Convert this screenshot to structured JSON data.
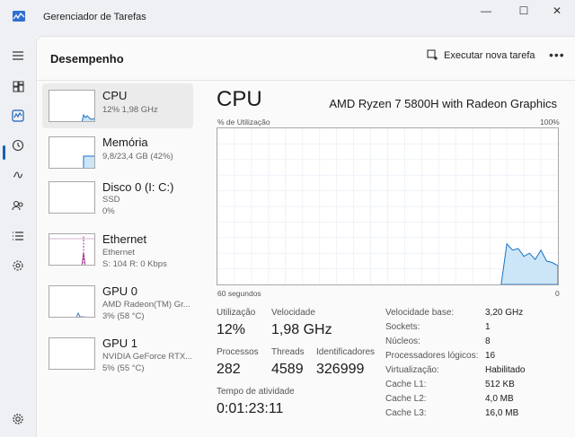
{
  "window": {
    "title": "Gerenciador de Tarefas",
    "minimize": "—",
    "maximize": "☐",
    "close": "✕"
  },
  "header": {
    "page_title": "Desempenho",
    "run_task_label": "Executar nova tarefa",
    "more_label": "•••"
  },
  "colors": {
    "cpu_accent": "#1a73c9",
    "cpu_fill": "#cde6f7",
    "disk_accent": "#4c9a2a",
    "ethernet_accent": "#a0358f",
    "gpu_accent": "#2b6cb0"
  },
  "sidebar": {
    "items": [
      {
        "name": "CPU",
        "sub1": "12%  1,98 GHz",
        "sub2": "",
        "level": 0.12
      },
      {
        "name": "Memória",
        "sub1": "9,8/23,4 GB (42%)",
        "sub2": "",
        "level": 0.42
      },
      {
        "name": "Disco 0 (I: C:)",
        "sub1": "SSD",
        "sub2": "0%",
        "level": 0
      },
      {
        "name": "Ethernet",
        "sub1": "Ethernet",
        "sub2": "S: 104  R: 0 Kbps",
        "level": 0
      },
      {
        "name": "GPU 0",
        "sub1": "AMD Radeon(TM) Gr...",
        "sub2": "3%  (58 °C)",
        "level": 0.03
      },
      {
        "name": "GPU 1",
        "sub1": "NVIDIA GeForce RTX...",
        "sub2": "5%  (55 °C)",
        "level": 0.05
      }
    ]
  },
  "detail": {
    "title": "CPU",
    "model": "AMD Ryzen 7 5800H with Radeon Graphics",
    "graph_top_left": "% de Utilização",
    "graph_top_right": "100%",
    "graph_bottom_left": "60 segundos",
    "graph_bottom_right": "0",
    "utilization_label": "Utilização",
    "utilization_value": "12%",
    "speed_label": "Velocidade",
    "speed_value": "1,98 GHz",
    "processes_label": "Processos",
    "processes_value": "282",
    "threads_label": "Threads",
    "threads_value": "4589",
    "handles_label": "Identificadores",
    "handles_value": "326999",
    "uptime_label": "Tempo de atividade",
    "uptime_value": "0:01:23:11",
    "specs": [
      {
        "key": "Velocidade base:",
        "value": "3,20 GHz"
      },
      {
        "key": "Sockets:",
        "value": "1"
      },
      {
        "key": "Núcleos:",
        "value": "8"
      },
      {
        "key": "Processadores lógicos:",
        "value": "16"
      },
      {
        "key": "Virtualização:",
        "value": "Habilitado"
      },
      {
        "key": "Cache L1:",
        "value": "512 KB"
      },
      {
        "key": "Cache L2:",
        "value": "4,0 MB"
      },
      {
        "key": "Cache L3:",
        "value": "16,0 MB"
      }
    ],
    "usage_history": [
      0,
      0,
      0,
      0,
      0,
      0,
      0,
      0,
      0,
      0,
      0,
      0,
      0,
      0,
      0,
      0,
      0,
      0,
      0,
      0,
      0,
      0,
      0,
      0,
      0,
      0,
      0,
      0,
      0,
      0,
      0,
      0,
      0,
      0,
      0,
      0,
      0,
      0,
      0,
      0,
      0,
      0,
      0,
      0,
      0,
      0,
      0,
      0,
      0,
      0,
      0,
      0.26,
      0.22,
      0.23,
      0.18,
      0.2,
      0.16,
      0.22,
      0.15,
      0.14,
      0.12
    ]
  }
}
